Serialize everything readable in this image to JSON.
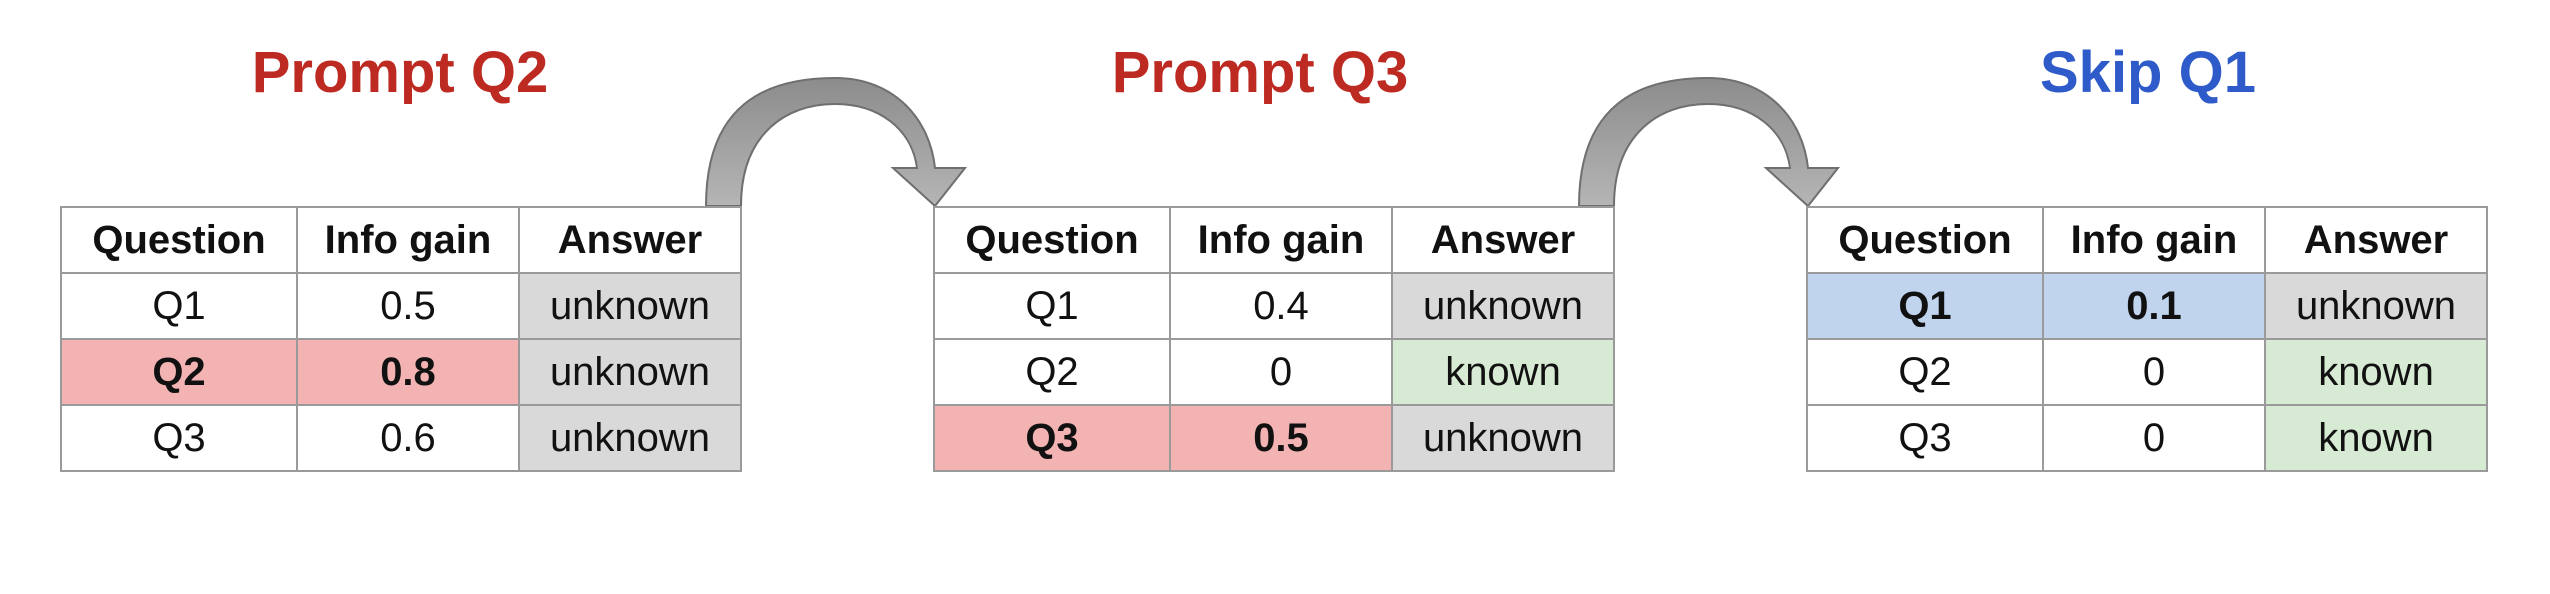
{
  "steps": [
    {
      "title": "Prompt Q2",
      "title_color": "#bd2a22",
      "headers": [
        "Question",
        "Info gain",
        "Answer"
      ],
      "rows": [
        {
          "question": "Q1",
          "gain": "0.5",
          "answer": "unknown",
          "answer_status": "unknown",
          "highlight": "none"
        },
        {
          "question": "Q2",
          "gain": "0.8",
          "answer": "unknown",
          "answer_status": "unknown",
          "highlight": "red"
        },
        {
          "question": "Q3",
          "gain": "0.6",
          "answer": "unknown",
          "answer_status": "unknown",
          "highlight": "none"
        }
      ]
    },
    {
      "title": "Prompt Q3",
      "title_color": "#bd2a22",
      "headers": [
        "Question",
        "Info gain",
        "Answer"
      ],
      "rows": [
        {
          "question": "Q1",
          "gain": "0.4",
          "answer": "unknown",
          "answer_status": "unknown",
          "highlight": "none"
        },
        {
          "question": "Q2",
          "gain": "0",
          "answer": "known",
          "answer_status": "known",
          "highlight": "none"
        },
        {
          "question": "Q3",
          "gain": "0.5",
          "answer": "unknown",
          "answer_status": "unknown",
          "highlight": "red"
        }
      ]
    },
    {
      "title": "Skip Q1",
      "title_color": "#2e5bc9",
      "headers": [
        "Question",
        "Info gain",
        "Answer"
      ],
      "rows": [
        {
          "question": "Q1",
          "gain": "0.1",
          "answer": "unknown",
          "answer_status": "unknown",
          "highlight": "blue"
        },
        {
          "question": "Q2",
          "gain": "0",
          "answer": "known",
          "answer_status": "known",
          "highlight": "none"
        },
        {
          "question": "Q3",
          "gain": "0",
          "answer": "known",
          "answer_status": "known",
          "highlight": "none"
        }
      ]
    }
  ],
  "colors": {
    "unknown_fill": "#d9d9d9",
    "known_fill": "#d7ead3",
    "highlight_red": "#f3b3b3",
    "highlight_blue": "#c0d4ee",
    "arrow_fill": "#a6a6a6"
  }
}
